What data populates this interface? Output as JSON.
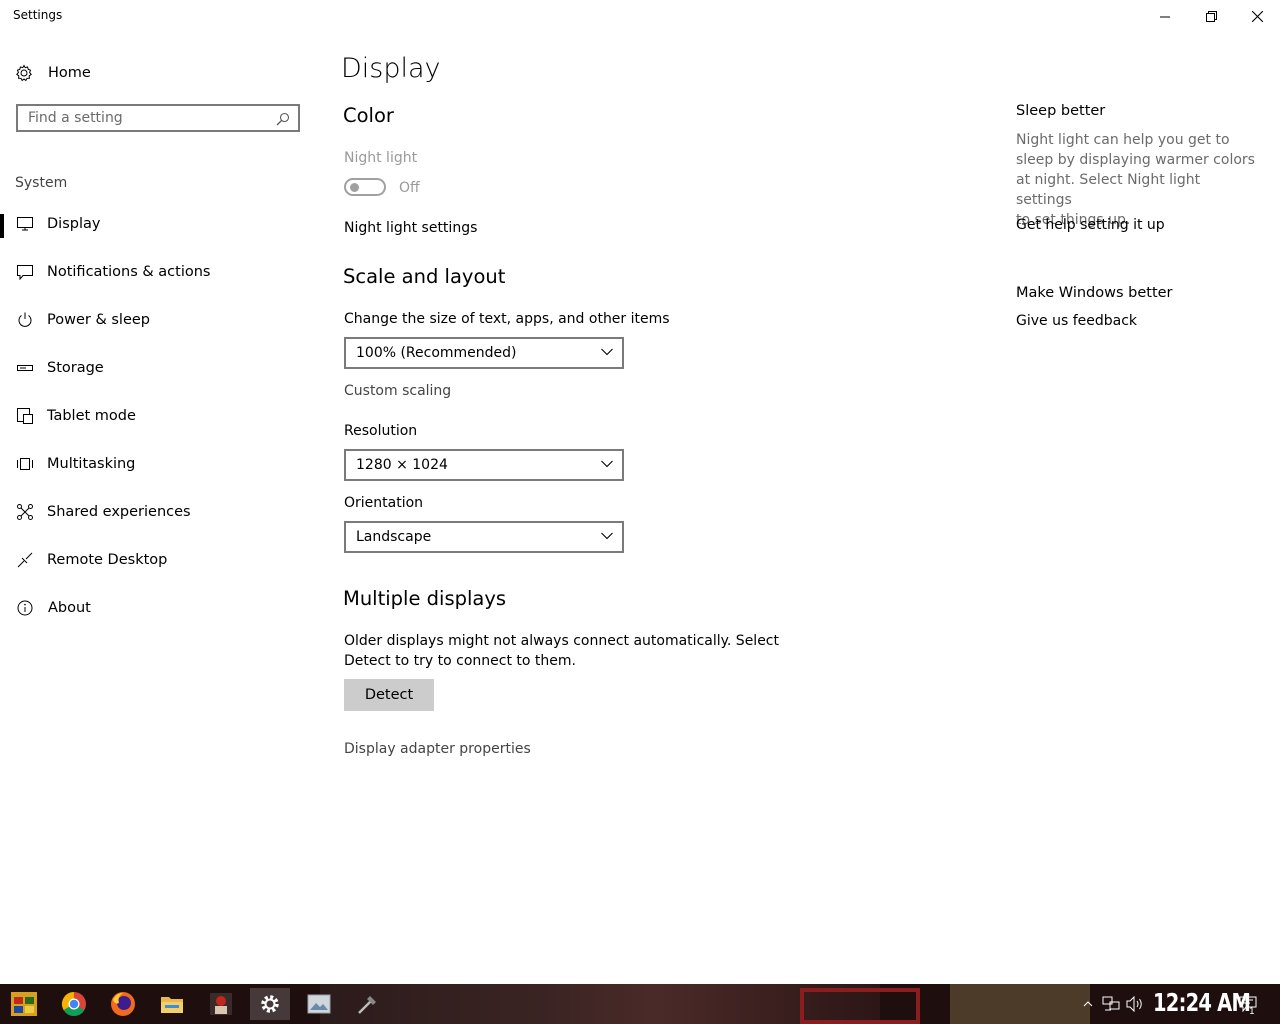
{
  "window": {
    "title": "Settings",
    "controls": {
      "minimize": "minimize-icon",
      "restore": "restore-icon",
      "close": "close-icon"
    }
  },
  "sidebar": {
    "home_label": "Home",
    "search_placeholder": "Find a setting",
    "section_label": "System",
    "items": [
      {
        "label": "Display",
        "icon": "monitor-icon",
        "active": true
      },
      {
        "label": "Notifications & actions",
        "icon": "notification-icon"
      },
      {
        "label": "Power & sleep",
        "icon": "power-icon"
      },
      {
        "label": "Storage",
        "icon": "storage-icon"
      },
      {
        "label": "Tablet mode",
        "icon": "tablet-mode-icon"
      },
      {
        "label": "Multitasking",
        "icon": "multitasking-icon"
      },
      {
        "label": "Shared experiences",
        "icon": "shared-experiences-icon"
      },
      {
        "label": "Remote Desktop",
        "icon": "remote-desktop-icon"
      },
      {
        "label": "About",
        "icon": "info-icon"
      }
    ]
  },
  "main": {
    "page_title": "Display",
    "color": {
      "title": "Color",
      "night_light_label": "Night light",
      "night_light_state": "Off",
      "night_light_settings_link": "Night light settings"
    },
    "scale_layout": {
      "title": "Scale and layout",
      "size_label": "Change the size of text, apps, and other items",
      "size_value": "100% (Recommended)",
      "custom_scaling_link": "Custom scaling",
      "resolution_label": "Resolution",
      "resolution_value": "1280 × 1024",
      "orientation_label": "Orientation",
      "orientation_value": "Landscape"
    },
    "multiple_displays": {
      "title": "Multiple displays",
      "description_line1": "Older displays might not always connect automatically. Select",
      "description_line2": "Detect to try to connect to them.",
      "detect_button": "Detect",
      "adapter_link": "Display adapter properties"
    }
  },
  "aside": {
    "sleep_title": "Sleep better",
    "sleep_lines": [
      "Night light can help you get to",
      "sleep by displaying warmer colors",
      "at night. Select Night light settings",
      "to set things up."
    ],
    "sleep_link": "Get help setting it up",
    "feedback_title": "Make Windows better",
    "feedback_link": "Give us feedback"
  },
  "taskbar": {
    "apps": [
      "start-icon",
      "chrome-icon",
      "firefox-icon",
      "file-explorer-icon",
      "photo-app-icon",
      "settings-gear-icon",
      "image-viewer-icon",
      "tool-icon"
    ],
    "active_app": "settings-gear-icon",
    "tray_icons": [
      "show-hidden-icons-chevron-icon",
      "network-icon",
      "volume-icon"
    ],
    "clock": "12:24 AM",
    "notification_count": "1"
  },
  "colors": {
    "background": "#ffffff",
    "text": "#000000",
    "muted_text": "#6b6b6b",
    "disabled_text": "#9a9a9a",
    "button_gray": "#cccccc",
    "taskbar": "#1e0e0e"
  }
}
